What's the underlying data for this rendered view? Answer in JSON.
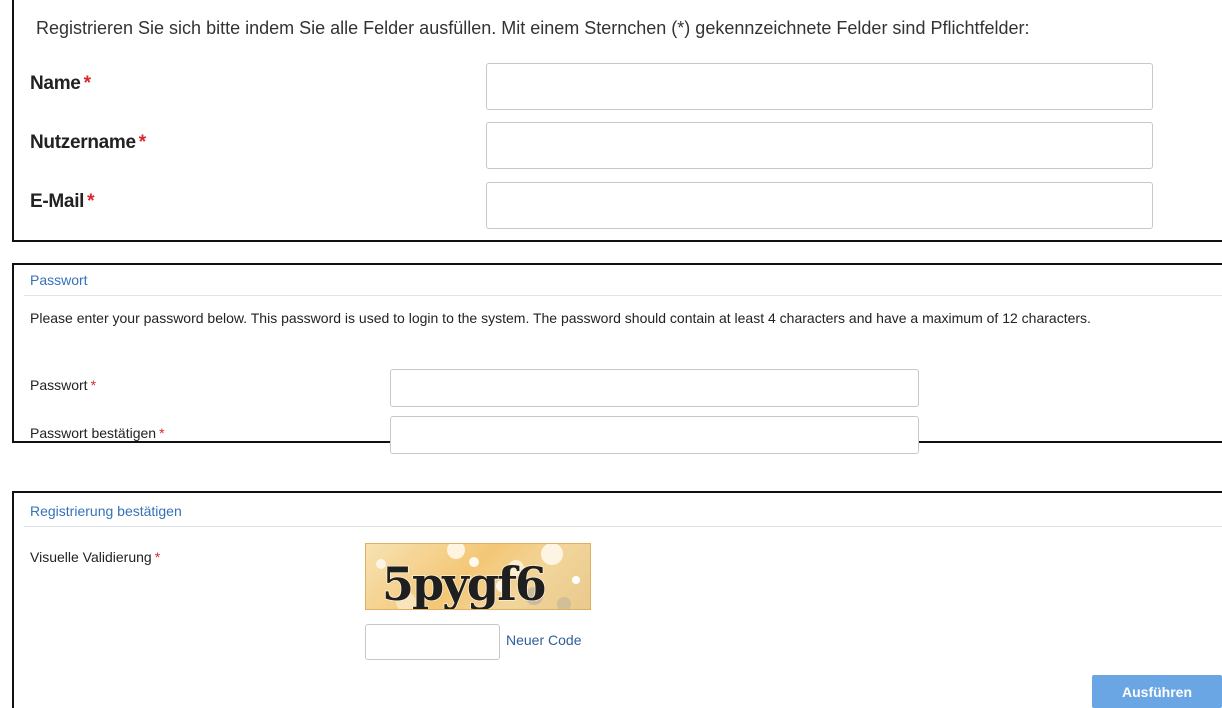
{
  "form": {
    "intro": "Registrieren Sie sich bitte indem Sie alle Felder ausfüllen. Mit einem Sternchen (*) gekennzeichnete Felder sind Pflichtfelder:",
    "required_marker": "*",
    "fields": [
      {
        "label": "Name",
        "value": "",
        "placeholder": ""
      },
      {
        "label": "Nutzername",
        "value": "",
        "placeholder": ""
      },
      {
        "label": "E-Mail",
        "value": "",
        "placeholder": ""
      }
    ]
  },
  "password_section": {
    "title": "Passwort",
    "description": "Please enter your password below. This password is used to login to the system. The password should contain at least 4 characters and have a maximum of 12 characters.",
    "fields": [
      {
        "label": "Passwort",
        "value": ""
      },
      {
        "label": "Passwort bestätigen",
        "value": ""
      }
    ]
  },
  "confirm_section": {
    "title": "Registrierung bestätigen",
    "captcha_label": "Visuelle Validierung",
    "captcha_text": "5pygf6",
    "code_value": "",
    "new_code_link": "Neuer Code",
    "submit_label": "Ausführen"
  },
  "colors": {
    "accent": "#3571b8",
    "required": "#d9262b",
    "submit_bg": "#69a6e3"
  }
}
